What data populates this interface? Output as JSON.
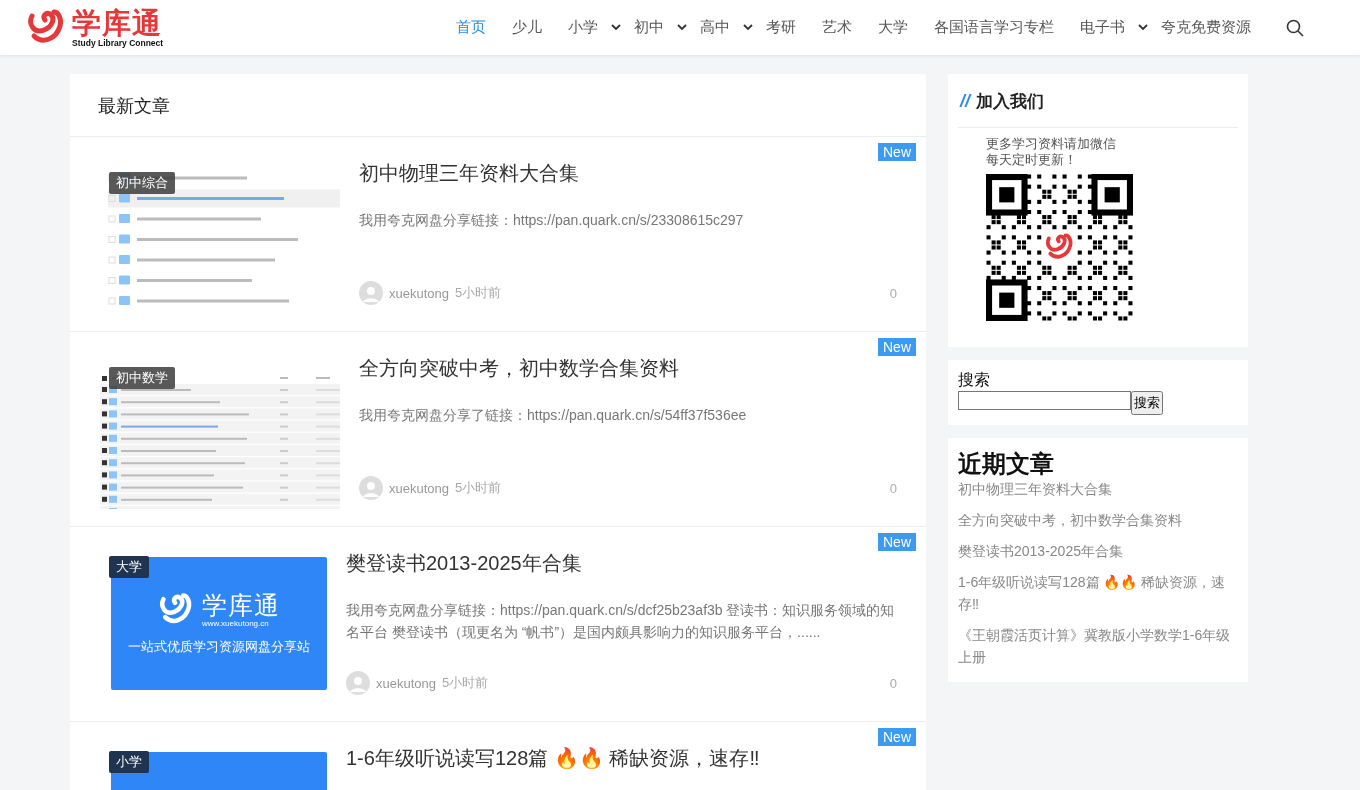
{
  "header": {
    "logo": {
      "name": "学库通",
      "tagline": "Study Library Connect"
    },
    "nav": [
      {
        "label": "首页",
        "selected": true,
        "dropdown": false
      },
      {
        "label": "少儿",
        "selected": false,
        "dropdown": false
      },
      {
        "label": "小学",
        "selected": false,
        "dropdown": true
      },
      {
        "label": "初中",
        "selected": false,
        "dropdown": true
      },
      {
        "label": "高中",
        "selected": false,
        "dropdown": true
      },
      {
        "label": "考研",
        "selected": false,
        "dropdown": false
      },
      {
        "label": "艺术",
        "selected": false,
        "dropdown": false
      },
      {
        "label": "大学",
        "selected": false,
        "dropdown": false
      },
      {
        "label": "各国语言学习专栏",
        "selected": false,
        "dropdown": false
      },
      {
        "label": "电子书",
        "selected": false,
        "dropdown": true
      },
      {
        "label": "夸克免费资源",
        "selected": false,
        "dropdown": false
      }
    ]
  },
  "main": {
    "title": "最新文章",
    "posts": [
      {
        "category": "初中综合",
        "thumbnail": {
          "kind": "file-list"
        },
        "badge": "New",
        "title": "初中物理三年资料大合集",
        "excerpt": "我用夸克网盘分享链接：https://pan.quark.cn/s/23308615c297",
        "author": "xuekutong",
        "time": "5小时前",
        "comments": "0"
      },
      {
        "category": "初中数学",
        "thumbnail": {
          "kind": "file-table"
        },
        "badge": "New",
        "title": "全方向突破中考，初中数学合集资料",
        "excerpt": "我用夸克网盘分享了链接：https://pan.quark.cn/s/54ff37f536ee",
        "author": "xuekutong",
        "time": "5小时前",
        "comments": "0"
      },
      {
        "category": "大学",
        "thumbnail": {
          "kind": "banner",
          "name": "学库通",
          "url": "www.xuekutong.cn",
          "slogan": "一站式优质学习资源网盘分享站"
        },
        "badge": "New",
        "title": "樊登读书2013-2025年合集",
        "excerpt": "我用夸克网盘分享链接：https://pan.quark.cn/s/dcf25b23af3b 登读书：知识服务领域的知名平台 樊登读书（现更名为 “帆书”）是国内颇具影响力的知识服务平台，......",
        "author": "xuekutong",
        "time": "5小时前",
        "comments": "0"
      },
      {
        "category": "小学",
        "thumbnail": {
          "kind": "banner"
        },
        "badge": "New",
        "title": "1-6年级听说读写128篇 🔥🔥 稀缺资源，速存‼"
      }
    ]
  },
  "sidebar": {
    "join": {
      "mark": "//",
      "title": "加入我们",
      "lines": [
        "更多学习资料请加微信",
        "每天定时更新！"
      ]
    },
    "search": {
      "label": "搜索",
      "button": "搜索"
    },
    "recent": {
      "title": "近期文章",
      "items": [
        "初中物理三年资料大合集",
        "全方向突破中考，初中数学合集资料",
        "樊登读书2013-2025年合集",
        "1-6年级听说读写128篇 🔥🔥 稀缺资源，速存‼",
        "《王朝霞活页计算》冀教版小学数学1-6年级上册"
      ]
    }
  }
}
